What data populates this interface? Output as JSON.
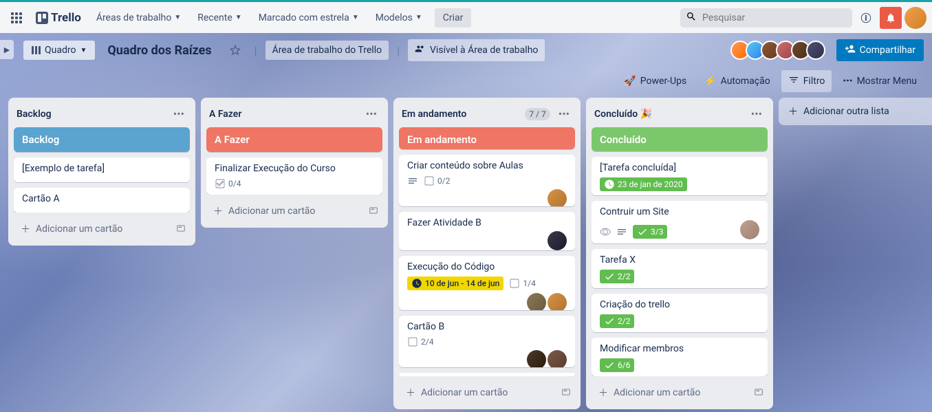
{
  "logo": "Trello",
  "nav": {
    "workspaces": "Áreas de trabalho",
    "recent": "Recente",
    "starred": "Marcado com estrela",
    "templates": "Modelos",
    "create": "Criar"
  },
  "search": {
    "placeholder": "Pesquisar"
  },
  "board": {
    "view_label": "Quadro",
    "title": "Quadro dos Raízes",
    "workspace_label": "Área de trabalho do Trello",
    "visibility_label": "Visível à Área de trabalho",
    "share_label": "Compartilhar",
    "powerups": "Power-Ups",
    "automation": "Automação",
    "filter": "Filtro",
    "menu": "Mostrar Menu"
  },
  "lists": {
    "backlog": {
      "title": "Backlog",
      "header_card": "Backlog",
      "cards": {
        "c1": "[Exemplo de tarefa]",
        "c2": "Cartão A"
      },
      "add": "Adicionar um cartão"
    },
    "todo": {
      "title": "A Fazer",
      "header_card": "A Fazer",
      "cards": {
        "c1": "Finalizar Execução do Curso"
      },
      "badges": {
        "c1_check": "0/4"
      },
      "add": "Adicionar um cartão"
    },
    "doing": {
      "title": "Em andamento",
      "count": "7 / 7",
      "header_card": "Em andamento",
      "cards": {
        "c1": "Criar conteúdo sobre Aulas",
        "c2": "Fazer Atividade B",
        "c3": "Execução do Código",
        "c4": "Cartão B"
      },
      "badges": {
        "c1_check": "0/2",
        "c3_date": "10 de jun - 14 de jun",
        "c3_check": "1/4",
        "c4_check": "2/4"
      },
      "add": "Adicionar um cartão"
    },
    "done": {
      "title": "Concluído 🎉",
      "header_card": "Concluído",
      "cards": {
        "c1": "[Tarefa concluída]",
        "c2": "Contruir um Site",
        "c3": "Tarefa X",
        "c4": "Criação do trello",
        "c5": "Modificar membros"
      },
      "badges": {
        "c1_date": "23 de jan de 2020",
        "c2_check": "3/3",
        "c3_check": "2/2",
        "c4_check": "2/2",
        "c5_check": "6/6"
      },
      "add": "Adicionar um cartão"
    }
  },
  "add_list": "Adicionar outra lista"
}
